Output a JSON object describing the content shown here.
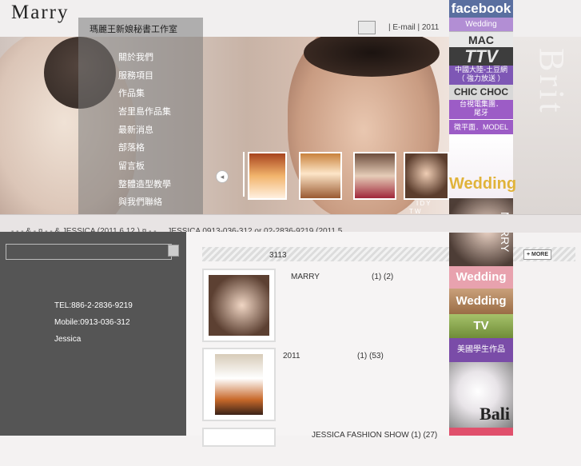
{
  "header": {
    "logo": "Marry",
    "studio_title": "瑪麗王新娘秘書工作室",
    "nav": "| E-mail | 2011"
  },
  "menu": [
    "關於我們",
    "服務項目",
    "作品集",
    "峇里島作品集",
    "最新消息",
    "部落格",
    "留言板",
    "整體造型教學",
    "與我們聯絡"
  ],
  "gallery": {
    "prev": "◂",
    "next": "▸",
    "thumb_caption": "I D Y",
    "thumb_caption2": "T W"
  },
  "sidebar_badges": {
    "facebook": "facebook",
    "wedding1": "Wedding",
    "mac": "MAC",
    "ttv": "TTV",
    "china": "中國大陸-土豆網\n（ 強力放送 ）",
    "chicchoc": "CHIC CHOC",
    "taiwan": "台視電集團．\n尾牙",
    "model": "徵平面．MODEL",
    "wedding_big": "Wedding",
    "marry": "MARRY",
    "wedding2": "Wedding",
    "wedding3": "Wedding",
    "tv": "TV",
    "student": "美國學生作品",
    "bali": "Bali",
    "deco_text": "Brit"
  },
  "marquee": {
    "text": "- - - & -        ¤     - - &         JESSICA    (2011 6 12 )    ¤     -     -     ,     ,    JESSICA    0913-036-312 or 02-2836-9219                           (2011 5"
  },
  "search": {
    "placeholder": ""
  },
  "contact": {
    "tel": "TEL:886-2-2836-9219",
    "mobile": "Mobile:0913-036-312",
    "name": "Jessica"
  },
  "news": {
    "count": "3113",
    "more": "+ MORE",
    "posts": [
      {
        "title": "MARRY",
        "count": "(1) (2)"
      },
      {
        "title": "2011",
        "count": "(1) (53)"
      },
      {
        "title": "JESSICA   FASHION SHOW (1) (27)",
        "count": ""
      }
    ]
  },
  "colors": {
    "facebook_bg": "#4a5d8c",
    "wedding_pink": "#e49aa4",
    "wedding_brown": "#b88a62",
    "tv_green": "#8aa84e",
    "student_purple": "#7a4ca8",
    "model_purple": "#9c5cc6"
  }
}
